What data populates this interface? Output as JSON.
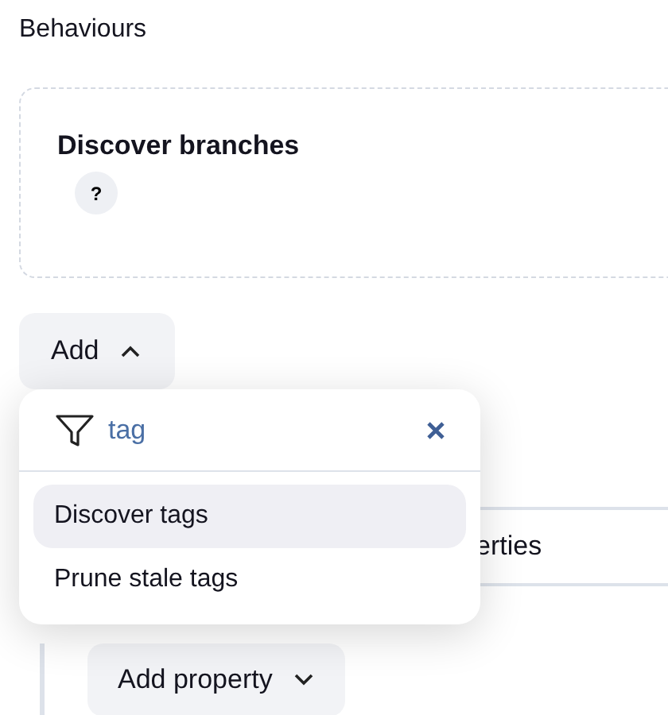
{
  "section_title": "Behaviours",
  "behaviour_card": {
    "title": "Discover branches",
    "help": "?"
  },
  "add_button": {
    "label": "Add",
    "expanded": true
  },
  "dropdown": {
    "filter": {
      "value": "tag"
    },
    "items": [
      {
        "label": "Discover tags",
        "selected": true
      },
      {
        "label": "Prune stale tags",
        "selected": false
      }
    ]
  },
  "properties_bar": {
    "label": "erties"
  },
  "add_property_button": {
    "label": "Add property",
    "expanded": false
  }
}
